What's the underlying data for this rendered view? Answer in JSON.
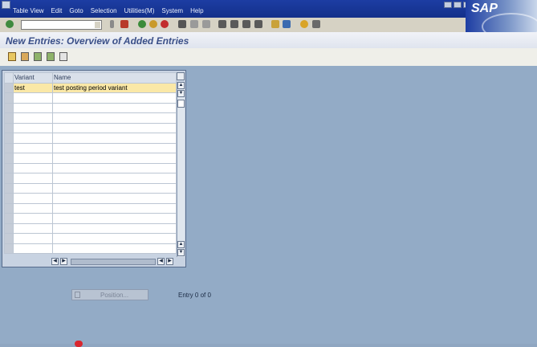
{
  "menubar": {
    "items": [
      "Table View",
      "Edit",
      "Goto",
      "Selection",
      "Utilities(M)",
      "System",
      "Help"
    ]
  },
  "brand": {
    "logo": "SAP"
  },
  "toolbar": {
    "command_value": ""
  },
  "screen": {
    "title": "New Entries: Overview of Added Entries"
  },
  "table": {
    "columns": [
      "Variant",
      "Name"
    ],
    "rows": [
      {
        "variant": "test",
        "name": "test posting period variant"
      }
    ],
    "empty_rows": 16
  },
  "footer": {
    "position_label": "Position...",
    "entry_text": "Entry 0 of 0"
  },
  "colors": {
    "menubar": "#1d3da3",
    "highlight_row": "#fae8a7",
    "workspace": "#93abc6"
  },
  "icons": [
    "enter-icon",
    "save-icon",
    "back-icon",
    "exit-icon",
    "cancel-icon",
    "print-icon",
    "find-icon",
    "layout-icon",
    "help-icon",
    "edit-icon",
    "copy-icon",
    "delete-icon"
  ]
}
